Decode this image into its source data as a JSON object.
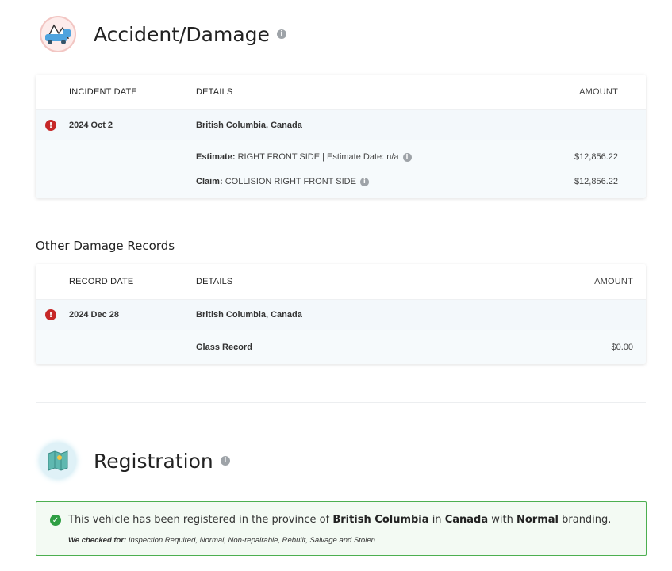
{
  "accident_section": {
    "title": "Accident/Damage",
    "icon": "tow-truck-icon",
    "info_icon": "info-icon",
    "table": {
      "headers": {
        "date": "INCIDENT DATE",
        "details": "DETAILS",
        "amount": "AMOUNT"
      },
      "record": {
        "date": "2024 Oct 2",
        "location": "British Columbia, Canada",
        "items": [
          {
            "label": "Estimate:",
            "text": "RIGHT FRONT SIDE | Estimate Date: n/a",
            "amount": "$12,856.22"
          },
          {
            "label": "Claim:",
            "text": "COLLISION RIGHT FRONT SIDE",
            "amount": "$12,856.22"
          }
        ]
      }
    }
  },
  "other_damage": {
    "title": "Other Damage Records",
    "table": {
      "headers": {
        "date": "RECORD DATE",
        "details": "DETAILS",
        "amount": "AMOUNT"
      },
      "record": {
        "date": "2024 Dec 28",
        "location": "British Columbia, Canada",
        "item": {
          "label": "Glass Record",
          "amount": "$0.00"
        }
      }
    }
  },
  "registration_section": {
    "title": "Registration",
    "icon": "map-icon",
    "message": {
      "prefix": "This vehicle has been registered in the province of",
      "province": "British Columbia",
      "in": "in",
      "country": "Canada",
      "with": "with",
      "branding": "Normal",
      "suffix": "branding."
    },
    "checked_label": "We checked for:",
    "checked_list": "Inspection Required, Normal, Non-repairable, Rebuilt, Salvage and Stolen."
  },
  "colors": {
    "alert": "#c62828",
    "success": "#2e9e43",
    "success_border": "#4caf50"
  }
}
